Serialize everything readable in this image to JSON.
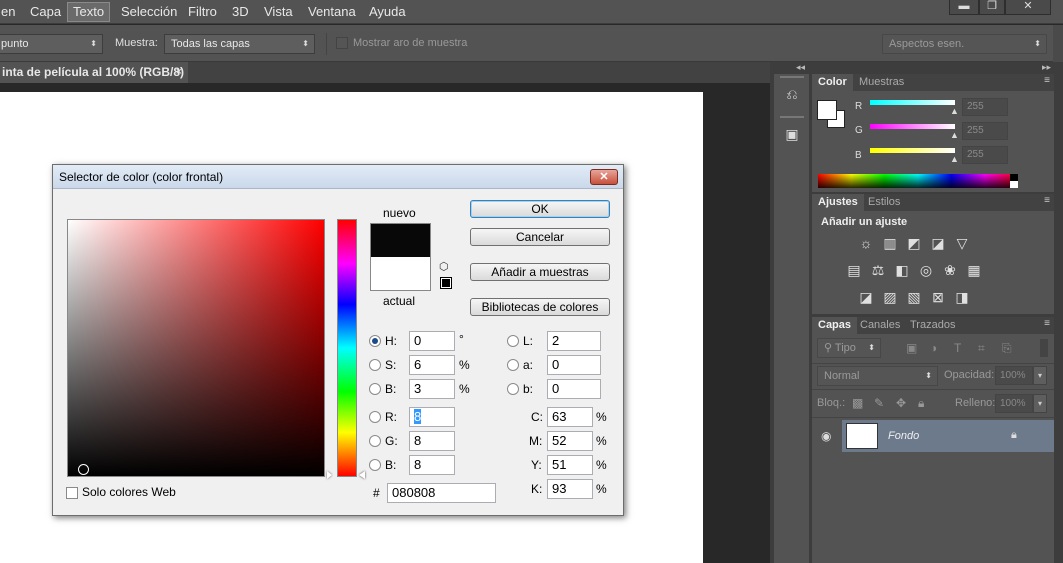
{
  "menubar": {
    "items": [
      "en",
      "Capa",
      "Texto",
      "Selección",
      "Filtro",
      "3D",
      "Vista",
      "Ventana",
      "Ayuda"
    ],
    "selected": "Texto",
    "window_buttons": [
      "▬",
      "❐",
      "✕"
    ]
  },
  "options": {
    "sample_size_value": "punto",
    "sample_label": "Muestra:",
    "sample_value": "Todas las capas",
    "show_ring_label": "Mostrar aro de muestra",
    "workspace_value": "Aspectos esen."
  },
  "document_tab": {
    "title": "inta de película al 100% (RGB/8)",
    "close": "×"
  },
  "color_panel": {
    "tabs": [
      "Color",
      "Muestras"
    ],
    "channels": [
      {
        "label": "R",
        "value": "255",
        "color": "#00ffff"
      },
      {
        "label": "G",
        "value": "255",
        "color": "#ff00ff"
      },
      {
        "label": "B",
        "value": "255",
        "color": "#ffff00"
      }
    ]
  },
  "adjustments_panel": {
    "tabs": [
      "Ajustes",
      "Estilos"
    ],
    "heading": "Añadir un ajuste"
  },
  "layers_panel": {
    "tabs": [
      "Capas",
      "Canales",
      "Trazados"
    ],
    "filter_label": "Tipo",
    "blend_mode": "Normal",
    "opacity_label": "Opacidad:",
    "opacity_value": "100%",
    "lock_label": "Bloq.:",
    "fill_label": "Relleno:",
    "fill_value": "100%",
    "layer_name": "Fondo"
  },
  "color_picker": {
    "title": "Selector de color (color frontal)",
    "new_label": "nuevo",
    "current_label": "actual",
    "new_color": "#080808",
    "current_color": "#ffffff",
    "buttons": {
      "ok": "OK",
      "cancel": "Cancelar",
      "add_swatch": "Añadir a muestras",
      "libraries": "Bibliotecas de colores"
    },
    "hsb": [
      {
        "label": "H:",
        "value": "0",
        "unit": "°",
        "selected": true
      },
      {
        "label": "S:",
        "value": "6",
        "unit": "%"
      },
      {
        "label": "B:",
        "value": "3",
        "unit": "%"
      }
    ],
    "rgb": [
      {
        "label": "R:",
        "value": "8"
      },
      {
        "label": "G:",
        "value": "8"
      },
      {
        "label": "B:",
        "value": "8"
      }
    ],
    "lab": [
      {
        "label": "L:",
        "value": "2"
      },
      {
        "label": "a:",
        "value": "0"
      },
      {
        "label": "b:",
        "value": "0"
      }
    ],
    "cmyk": [
      {
        "label": "C:",
        "value": "63",
        "unit": "%"
      },
      {
        "label": "M:",
        "value": "52",
        "unit": "%"
      },
      {
        "label": "Y:",
        "value": "51",
        "unit": "%"
      },
      {
        "label": "K:",
        "value": "93",
        "unit": "%"
      }
    ],
    "hex_label": "#",
    "hex_value": "080808",
    "web_only_label": "Solo colores Web"
  }
}
